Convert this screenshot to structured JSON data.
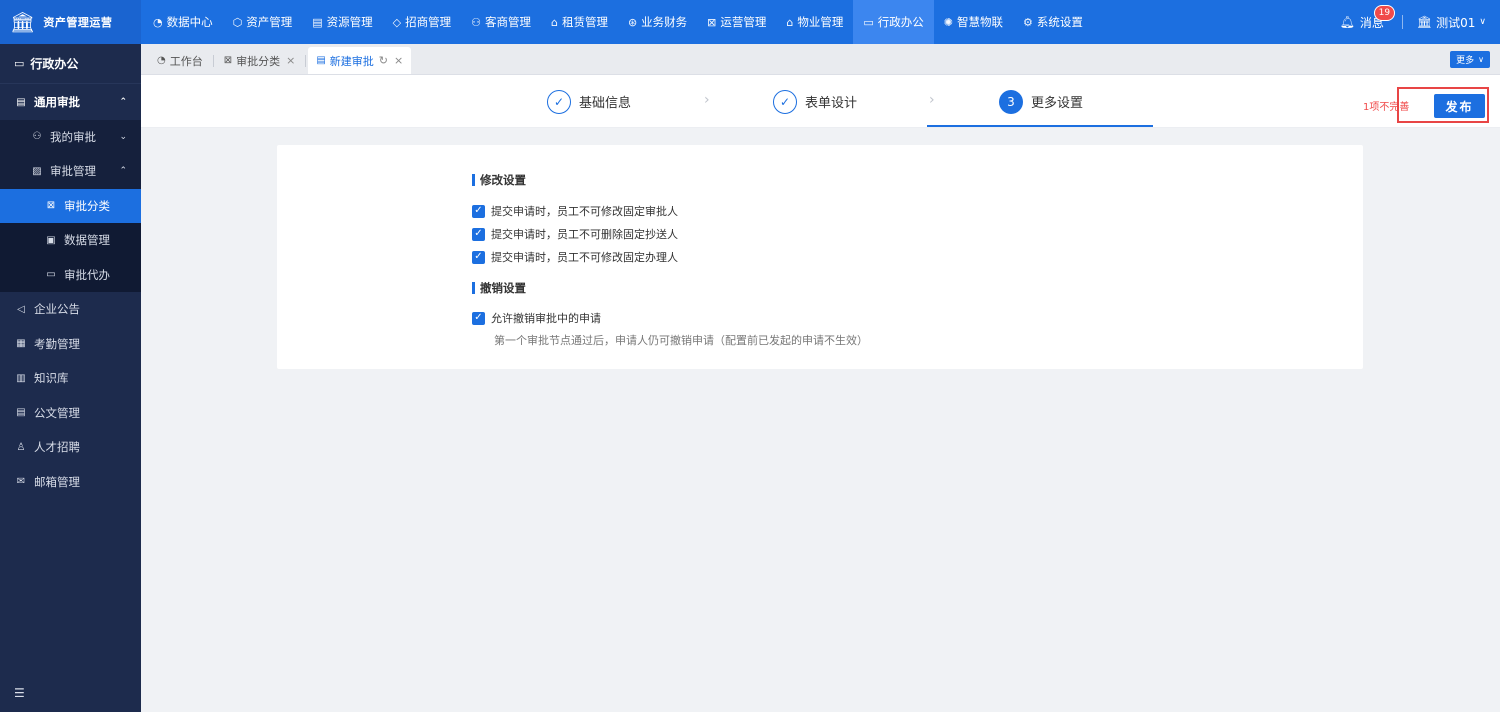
{
  "brand": {
    "logo": "bank-icon",
    "title": "资产管理运营"
  },
  "nav": [
    {
      "label": "数据中心",
      "icon": "◔"
    },
    {
      "label": "资产管理",
      "icon": "⬡"
    },
    {
      "label": "资源管理",
      "icon": "▤"
    },
    {
      "label": "招商管理",
      "icon": "◇"
    },
    {
      "label": "客商管理",
      "icon": "⚇"
    },
    {
      "label": "租赁管理",
      "icon": "⌂"
    },
    {
      "label": "业务财务",
      "icon": "⊛"
    },
    {
      "label": "运营管理",
      "icon": "⊠"
    },
    {
      "label": "物业管理",
      "icon": "⌂"
    },
    {
      "label": "行政办公",
      "icon": "▭",
      "active": true
    },
    {
      "label": "智慧物联",
      "icon": "✺"
    },
    {
      "label": "系统设置",
      "icon": "⚙"
    }
  ],
  "header": {
    "messages_label": "消息",
    "messages_count": "19",
    "user_name": "测试01"
  },
  "sidebar": {
    "head": "行政办公",
    "items": [
      {
        "label": "通用审批",
        "icon": "▤"
      },
      {
        "label": "我的审批",
        "icon": "⚇"
      },
      {
        "label": "审批管理",
        "icon": "▨"
      },
      {
        "label": "审批分类",
        "icon": "⊠"
      },
      {
        "label": "数据管理",
        "icon": "▣"
      },
      {
        "label": "审批代办",
        "icon": "▭"
      },
      {
        "label": "企业公告",
        "icon": "◁"
      },
      {
        "label": "考勤管理",
        "icon": "▦"
      },
      {
        "label": "知识库",
        "icon": "▥"
      },
      {
        "label": "公文管理",
        "icon": "▤"
      },
      {
        "label": "人才招聘",
        "icon": "♙"
      },
      {
        "label": "邮箱管理",
        "icon": "✉"
      }
    ],
    "footer_icon": "menu-collapse-icon"
  },
  "tabs": [
    {
      "label": "工作台",
      "icon": "◔"
    },
    {
      "label": "审批分类",
      "icon": "⊠"
    },
    {
      "label": "新建审批",
      "icon": "▤"
    }
  ],
  "more_label": "更多",
  "steps": [
    {
      "label": "基础信息",
      "state": "done"
    },
    {
      "label": "表单设计",
      "state": "done"
    },
    {
      "label": "更多设置",
      "state": "current",
      "number": "3"
    }
  ],
  "warning_text": "1项不完善",
  "publish_label": "发布",
  "form": {
    "section1_title": "修改设置",
    "section1_options": [
      {
        "label": "提交申请时，员工不可修改固定审批人",
        "checked": true
      },
      {
        "label": "提交申请时，员工不可删除固定抄送人",
        "checked": true
      },
      {
        "label": "提交申请时，员工不可修改固定办理人",
        "checked": true
      }
    ],
    "section2_title": "撤销设置",
    "section2_options": [
      {
        "label": "允许撤销审批中的申请",
        "checked": true
      }
    ],
    "section2_hint": "第一个审批节点通过后，申请人仍可撤销申请（配置前已发起的申请不生效）"
  },
  "colors": {
    "primary": "#1c6fe0",
    "sidebar": "#1d2b4d",
    "danger": "#f04a4a"
  }
}
